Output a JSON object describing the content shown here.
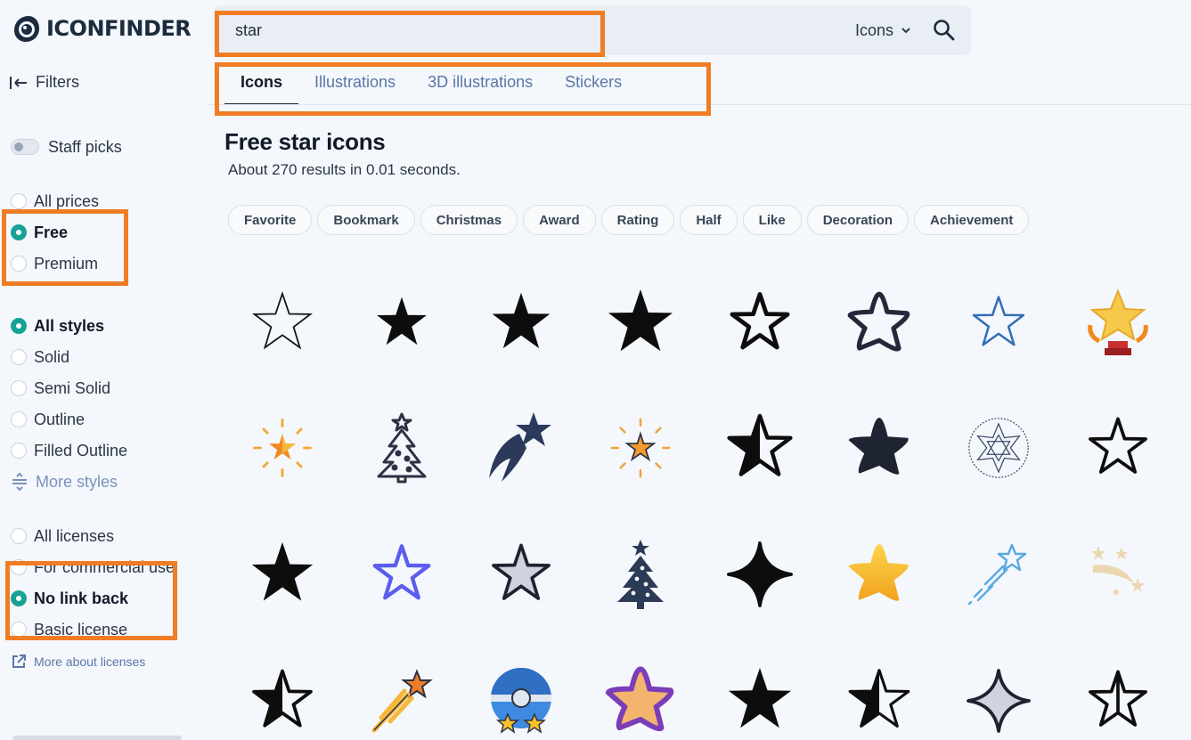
{
  "logo": {
    "text": "ICONFINDER"
  },
  "search": {
    "value": "star",
    "type_label": "Icons"
  },
  "tabs": [
    {
      "label": "Icons",
      "active": true
    },
    {
      "label": "Illustrations",
      "active": false
    },
    {
      "label": "3D illustrations",
      "active": false
    },
    {
      "label": "Stickers",
      "active": false
    }
  ],
  "sidebar": {
    "filters_label": "Filters",
    "staff_picks": "Staff picks",
    "prices": [
      {
        "label": "All prices",
        "selected": false
      },
      {
        "label": "Free",
        "selected": true
      },
      {
        "label": "Premium",
        "selected": false
      }
    ],
    "styles": [
      {
        "label": "All styles",
        "selected": true
      },
      {
        "label": "Solid",
        "selected": false
      },
      {
        "label": "Semi Solid",
        "selected": false
      },
      {
        "label": "Outline",
        "selected": false
      },
      {
        "label": "Filled Outline",
        "selected": false
      }
    ],
    "more_styles": "More styles",
    "licenses": [
      {
        "label": "All licenses",
        "selected": false
      },
      {
        "label": "For commercial use",
        "selected": false
      },
      {
        "label": "No link back",
        "selected": true
      },
      {
        "label": "Basic license",
        "selected": false
      }
    ],
    "more_licenses": "More about licenses"
  },
  "main": {
    "title": "Free star icons",
    "results": "About 270 results in 0.01 seconds.",
    "chips": [
      "Favorite",
      "Bookmark",
      "Christmas",
      "Award",
      "Rating",
      "Half",
      "Like",
      "Decoration",
      "Achievement"
    ]
  },
  "icons": [
    [
      "star-outline-thin-icon",
      "star-solid-small-icon",
      "star-solid-icon",
      "star-solid-large-icon",
      "star-outline-bold-icon",
      "star-rounded-outline-icon",
      "star-outline-blue-icon",
      "star-trophy-gold-icon"
    ],
    [
      "star-sparkle-orange-icon",
      "christmas-tree-outline-icon",
      "shooting-star-navy-icon",
      "star-burst-color-icon",
      "star-half-outline-icon",
      "star-rounded-solid-icon",
      "star-ornament-dotted-icon",
      "star-outline-rounded-icon"
    ],
    [
      "star-solid-black-icon",
      "star-outline-purple-icon",
      "star-gray-outline-icon",
      "christmas-tree-solid-icon",
      "four-point-star-solid-icon",
      "star-gold-gradient-icon",
      "shooting-star-blue-icon",
      "shooting-stars-beige-icon"
    ],
    [
      "star-half-solid-icon",
      "shooting-star-orange-icon",
      "pokeball-stars-icon",
      "star-purple-orange-icon",
      "star-solid-black-2-icon",
      "star-half-black-icon",
      "four-point-star-gray-icon",
      "star-half-outline-2-icon"
    ]
  ],
  "colors": {
    "accent_teal": "#16a394",
    "annotation_orange": "#f07d24",
    "link_blue": "#5a77a8"
  }
}
